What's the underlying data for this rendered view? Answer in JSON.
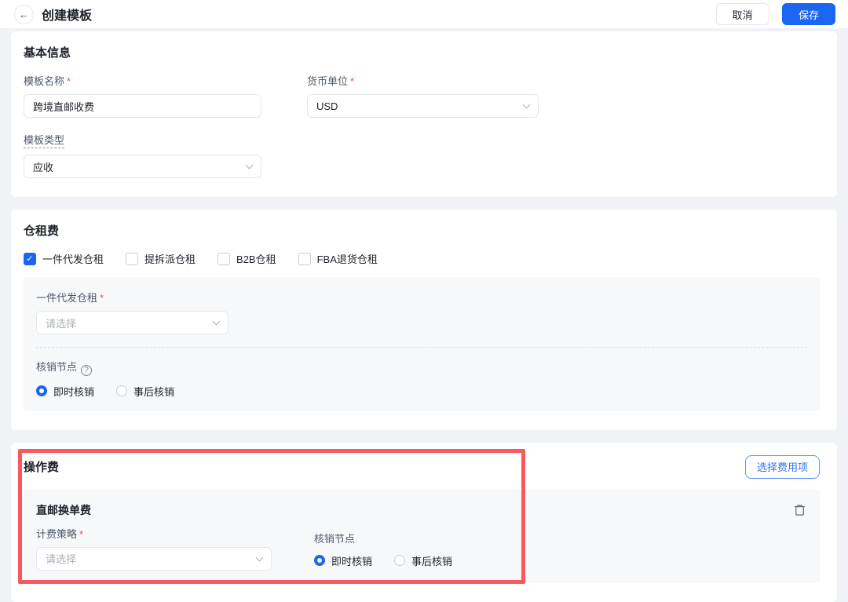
{
  "header": {
    "title": "创建模板",
    "cancel": "取消",
    "save": "保存"
  },
  "icons": {
    "back": "←",
    "check": "✓",
    "question": "?"
  },
  "basic_info": {
    "title": "基本信息",
    "required_mark": "*",
    "template_name_label": "模板名称",
    "template_name_value": "跨境直邮收费",
    "currency_label": "货币单位",
    "currency_value": "USD",
    "template_type_label": "模板类型",
    "template_type_value": "应收"
  },
  "warehouse_fee": {
    "title": "仓租费",
    "checkboxes": [
      {
        "label": "一件代发仓租",
        "checked": true
      },
      {
        "label": "提拆派仓租",
        "checked": false
      },
      {
        "label": "B2B仓租",
        "checked": false
      },
      {
        "label": "FBA退货仓租",
        "checked": false
      }
    ],
    "panel": {
      "select_label": "一件代发仓租",
      "required_mark": "*",
      "select_placeholder": "请选择",
      "writeoff_label": "核销节点",
      "radios": [
        {
          "label": "即时核销",
          "selected": true
        },
        {
          "label": "事后核销",
          "selected": false
        }
      ]
    }
  },
  "operation_fee": {
    "title": "操作费",
    "select_fee_button": "选择费用项",
    "panel": {
      "title": "直邮换单费",
      "strategy_label": "计费策略",
      "required_mark": "*",
      "strategy_placeholder": "请选择",
      "writeoff_label": "核销节点",
      "radios": [
        {
          "label": "即时核销",
          "selected": true
        },
        {
          "label": "事后核销",
          "selected": false
        }
      ]
    }
  },
  "colors": {
    "primary": "#1B66F0",
    "outline_button": "#3370FF",
    "annotation": "#F9585C",
    "required": "#F54A45",
    "panel_bg": "#F7F8FA",
    "page_bg": "#F1F2F6"
  }
}
